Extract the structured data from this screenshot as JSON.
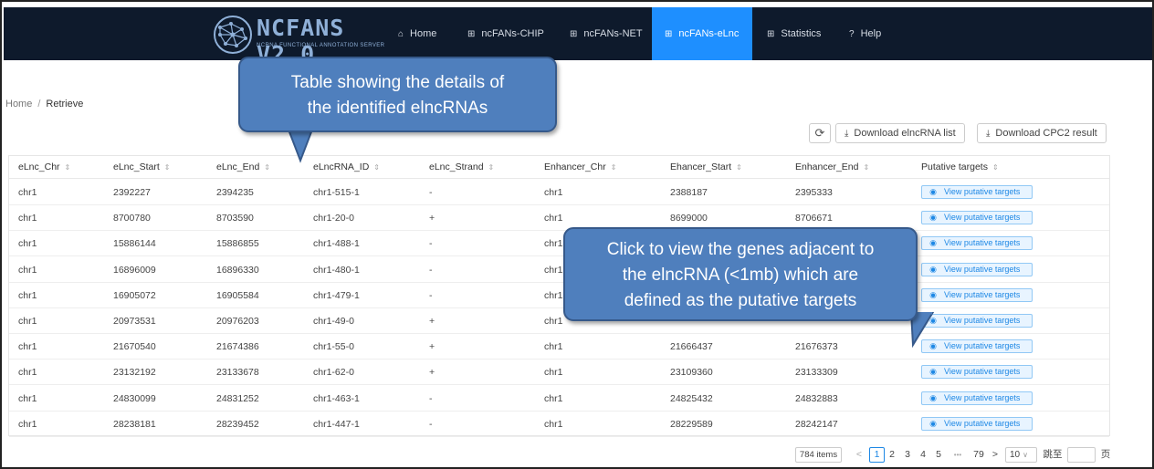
{
  "nav": {
    "logo_title": "NCFANS V2.0",
    "logo_subtitle": "NCRNA FUNCTIONAL ANNOTATION SERVER",
    "items": [
      {
        "label": "Home",
        "icon": "home-icon",
        "active": false
      },
      {
        "label": "ncFANs-CHIP",
        "icon": "grid-icon",
        "active": false
      },
      {
        "label": "ncFANs-NET",
        "icon": "grid-icon",
        "active": false
      },
      {
        "label": "ncFANs-eLnc",
        "icon": "grid-icon",
        "active": true
      },
      {
        "label": "Statistics",
        "icon": "grid-icon",
        "active": false
      },
      {
        "label": "Help",
        "icon": "help-icon",
        "active": false
      }
    ]
  },
  "breadcrumb": {
    "home": "Home",
    "separator": "/",
    "current": "Retrieve"
  },
  "toolbar": {
    "refresh_icon": "refresh-icon",
    "download_list_label": "Download elncRNA list",
    "download_cpc2_label": "Download CPC2 result"
  },
  "table": {
    "columns": [
      "eLnc_Chr",
      "eLnc_Start",
      "eLnc_End",
      "eLncRNA_ID",
      "eLnc_Strand",
      "Enhancer_Chr",
      "Ehancer_Start",
      "Enhancer_End",
      "Putative targets"
    ],
    "action_label": "View putative targets",
    "rows": [
      [
        "chr1",
        "2392227",
        "2394235",
        "chr1-515-1",
        "-",
        "chr1",
        "2388187",
        "2395333"
      ],
      [
        "chr1",
        "8700780",
        "8703590",
        "chr1-20-0",
        "+",
        "chr1",
        "8699000",
        "8706671"
      ],
      [
        "chr1",
        "15886144",
        "15886855",
        "chr1-488-1",
        "-",
        "chr1",
        "",
        ""
      ],
      [
        "chr1",
        "16896009",
        "16896330",
        "chr1-480-1",
        "-",
        "chr1",
        "",
        ""
      ],
      [
        "chr1",
        "16905072",
        "16905584",
        "chr1-479-1",
        "-",
        "chr1",
        "",
        ""
      ],
      [
        "chr1",
        "20973531",
        "20976203",
        "chr1-49-0",
        "+",
        "chr1",
        "",
        ""
      ],
      [
        "chr1",
        "21670540",
        "21674386",
        "chr1-55-0",
        "+",
        "chr1",
        "21666437",
        "21676373"
      ],
      [
        "chr1",
        "23132192",
        "23133678",
        "chr1-62-0",
        "+",
        "chr1",
        "23109360",
        "23133309"
      ],
      [
        "chr1",
        "24830099",
        "24831252",
        "chr1-463-1",
        "-",
        "chr1",
        "24825432",
        "24832883"
      ],
      [
        "chr1",
        "28238181",
        "28239452",
        "chr1-447-1",
        "-",
        "chr1",
        "28229589",
        "28242147"
      ]
    ]
  },
  "pagination": {
    "total": "784 items",
    "prev": "<",
    "pages": [
      "1",
      "2",
      "3",
      "4",
      "5"
    ],
    "current": "1",
    "ellipsis": "•••",
    "last": "79",
    "next": ">",
    "page_size": "10",
    "jump_label": "跳至",
    "page_suffix": "页"
  },
  "callouts": {
    "table_note": [
      "Table showing the details of",
      "the identified elncRNAs"
    ],
    "targets_note": [
      "Click to view the genes adjacent to",
      "the elncRNA (<1mb) which are",
      "defined as the putative targets"
    ]
  },
  "colors": {
    "nav_bg": "#0e1a2c",
    "active_tab": "#1e8fff",
    "callout_fill": "#4f7fbd",
    "link": "#1e88e5"
  }
}
